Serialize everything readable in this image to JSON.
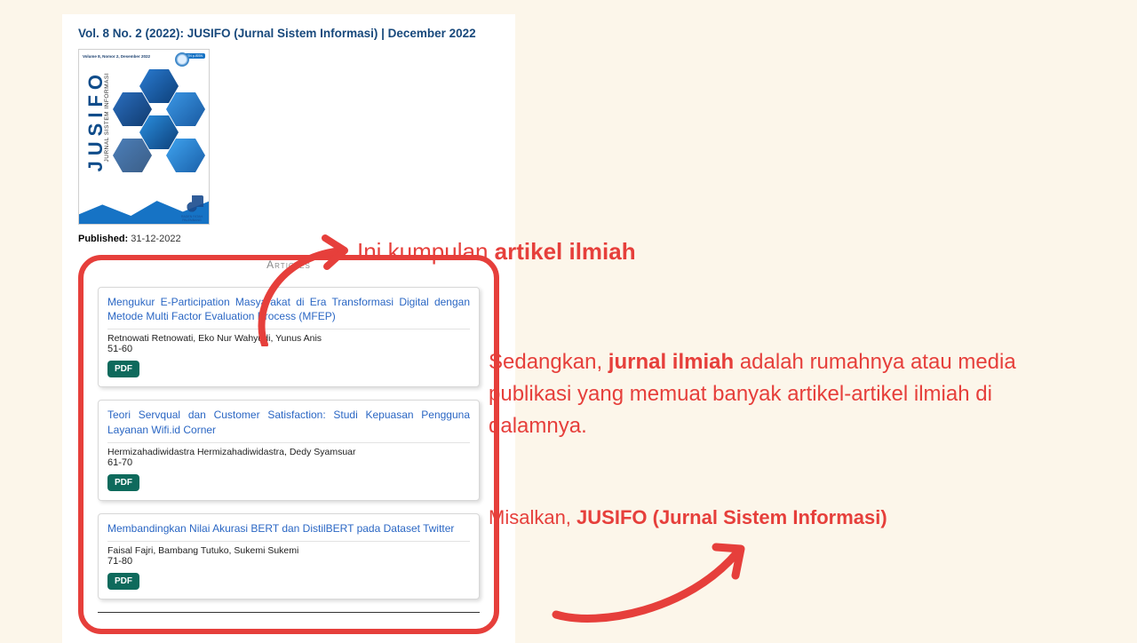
{
  "journal": {
    "issue_title": "Vol. 8 No. 2 (2022): JUSIFO (Jurnal Sistem Informasi) | December 2022",
    "cover": {
      "volume_line": "Volume 8, Nomor 2, Desember 2022",
      "brand": "JUSIFO",
      "brand_sub": "JURNAL SISTEM INFORMASI",
      "issn_label": "e-ISSN p-ISSN",
      "corner": "RADEN FATAH PALEMBANG"
    },
    "published_label": "Published:",
    "published_date": "31-12-2022",
    "articles_heading": "Articles",
    "pdf_label": "PDF",
    "articles": [
      {
        "title": "Mengukur E-Participation Masyarakat di Era Transformasi Digital dengan Metode Multi Factor Evaluation Process (MFEP)",
        "authors": "Retnowati Retnowati, Eko Nur Wahyudi, Yunus Anis",
        "pages": "51-60"
      },
      {
        "title": "Teori Servqual dan Customer Satisfaction: Studi Kepuasan Pengguna Layanan Wifi.id Corner",
        "authors": "Hermizahadiwidastra Hermizahadiwidastra, Dedy Syamsuar",
        "pages": "61-70"
      },
      {
        "title": "Membandingkan Nilai Akurasi BERT dan DistilBERT pada Dataset Twitter",
        "authors": "Faisal Fajri, Bambang Tutuko, Sukemi Sukemi",
        "pages": "71-80"
      }
    ]
  },
  "annotations": {
    "label1_pre": "Ini kumpulan ",
    "label1_bold": "artikel ilmiah",
    "para_pre": "Sedangkan, ",
    "para_bold": "jurnal ilmiah",
    "para_post": " adalah rumahnya atau media publikasi yang memuat banyak artikel-artikel ilmiah di dalamnya.",
    "example_pre": "Misalkan, ",
    "example_bold": "JUSIFO (Jurnal Sistem Informasi)"
  }
}
